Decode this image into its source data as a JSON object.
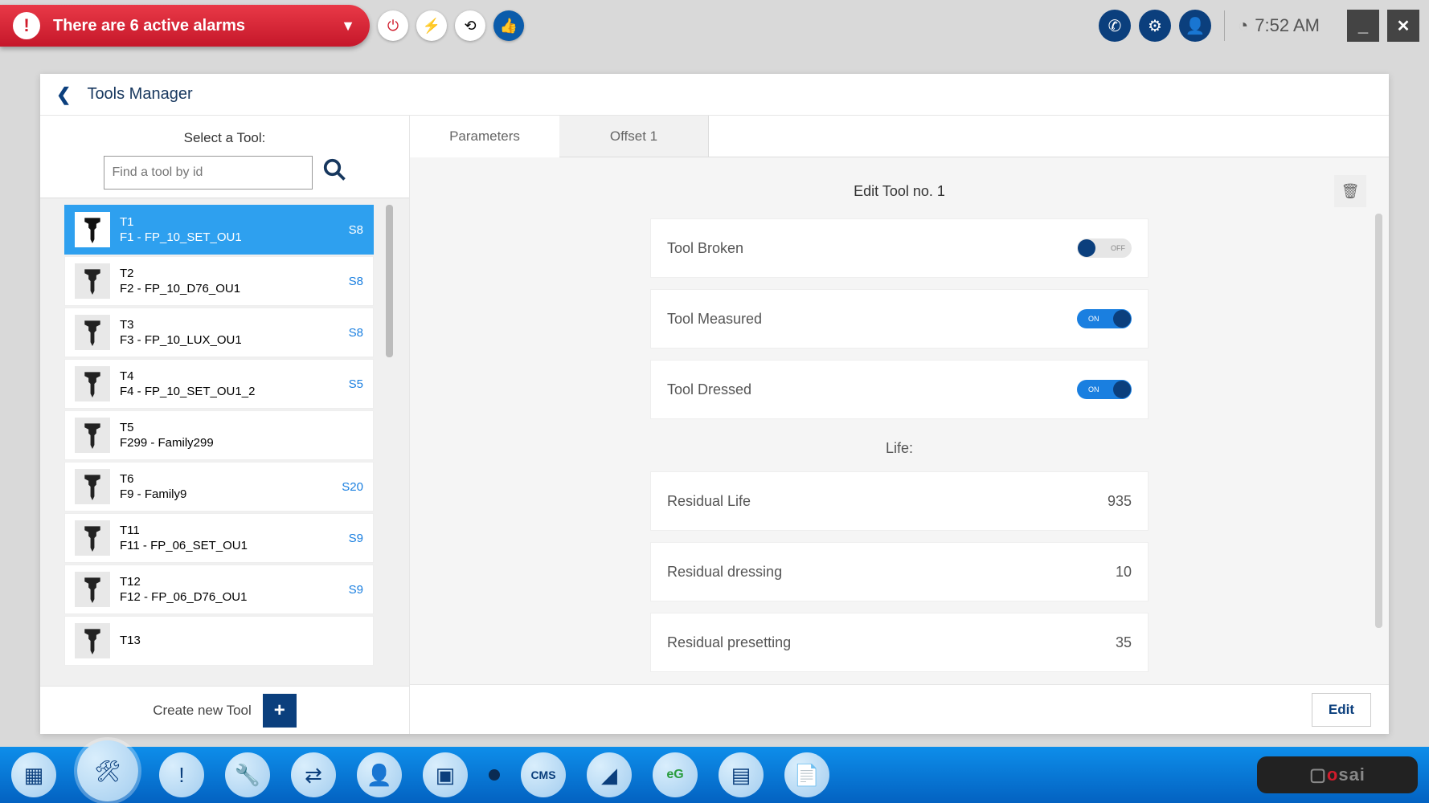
{
  "alarm": {
    "text": "There are 6 active alarms"
  },
  "time": "7:52 AM",
  "header": {
    "title": "Tools Manager"
  },
  "left": {
    "select_label": "Select a Tool:",
    "search_placeholder": "Find a tool by id",
    "create_label": "Create new Tool",
    "items": [
      {
        "id": "T1",
        "family": "F1 - FP_10_SET_OU1",
        "slot": "S8"
      },
      {
        "id": "T2",
        "family": "F2 - FP_10_D76_OU1",
        "slot": "S8"
      },
      {
        "id": "T3",
        "family": "F3 - FP_10_LUX_OU1",
        "slot": "S8"
      },
      {
        "id": "T4",
        "family": "F4 - FP_10_SET_OU1_2",
        "slot": "S5"
      },
      {
        "id": "T5",
        "family": "F299 - Family299",
        "slot": ""
      },
      {
        "id": "T6",
        "family": "F9 - Family9",
        "slot": "S20"
      },
      {
        "id": "T11",
        "family": "F11 - FP_06_SET_OU1",
        "slot": "S9"
      },
      {
        "id": "T12",
        "family": "F12 - FP_06_D76_OU1",
        "slot": "S9"
      },
      {
        "id": "T13",
        "family": "",
        "slot": ""
      }
    ]
  },
  "tabs": {
    "parameters": "Parameters",
    "offset1": "Offset 1"
  },
  "detail": {
    "title": "Edit Tool no. 1",
    "tool_broken": {
      "label": "Tool Broken",
      "state": "OFF"
    },
    "tool_measured": {
      "label": "Tool Measured",
      "state": "ON"
    },
    "tool_dressed": {
      "label": "Tool Dressed",
      "state": "ON"
    },
    "life_section": "Life:",
    "residual_life": {
      "label": "Residual Life",
      "value": "935"
    },
    "residual_dressing": {
      "label": "Residual dressing",
      "value": "10"
    },
    "residual_presetting": {
      "label": "Residual presetting",
      "value": "35"
    },
    "edit_button": "Edit"
  },
  "brand": {
    "part1": "o",
    "part2": "sai"
  }
}
